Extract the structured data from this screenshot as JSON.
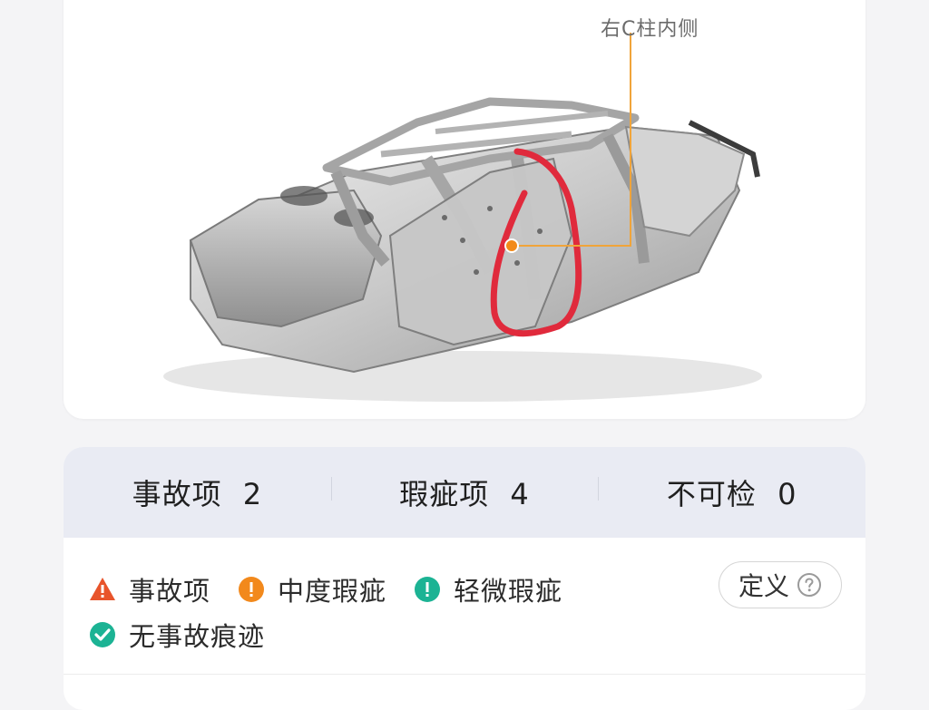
{
  "diagram": {
    "callout_label": "右C柱内侧"
  },
  "summary": {
    "tabs": [
      {
        "label": "事故项",
        "count": "2"
      },
      {
        "label": "瑕疵项",
        "count": "4"
      },
      {
        "label": "不可检",
        "count": "0"
      }
    ],
    "legend": [
      {
        "icon": "warning-triangle-icon",
        "label": "事故项",
        "color": "#e8542b"
      },
      {
        "icon": "exclamation-circle-icon",
        "label": "中度瑕疵",
        "color": "#f2891c"
      },
      {
        "icon": "exclamation-circle-icon",
        "label": "轻微瑕疵",
        "color": "#1cb394"
      },
      {
        "icon": "check-circle-icon",
        "label": "无事故痕迹",
        "color": "#1cb394"
      }
    ],
    "define_button": "定义"
  },
  "colors": {
    "tab_bg": "#e9ebf3",
    "callout_line": "#f0a43a",
    "marker_dot": "#f28a1a",
    "red_annotation": "#e02a3c"
  }
}
